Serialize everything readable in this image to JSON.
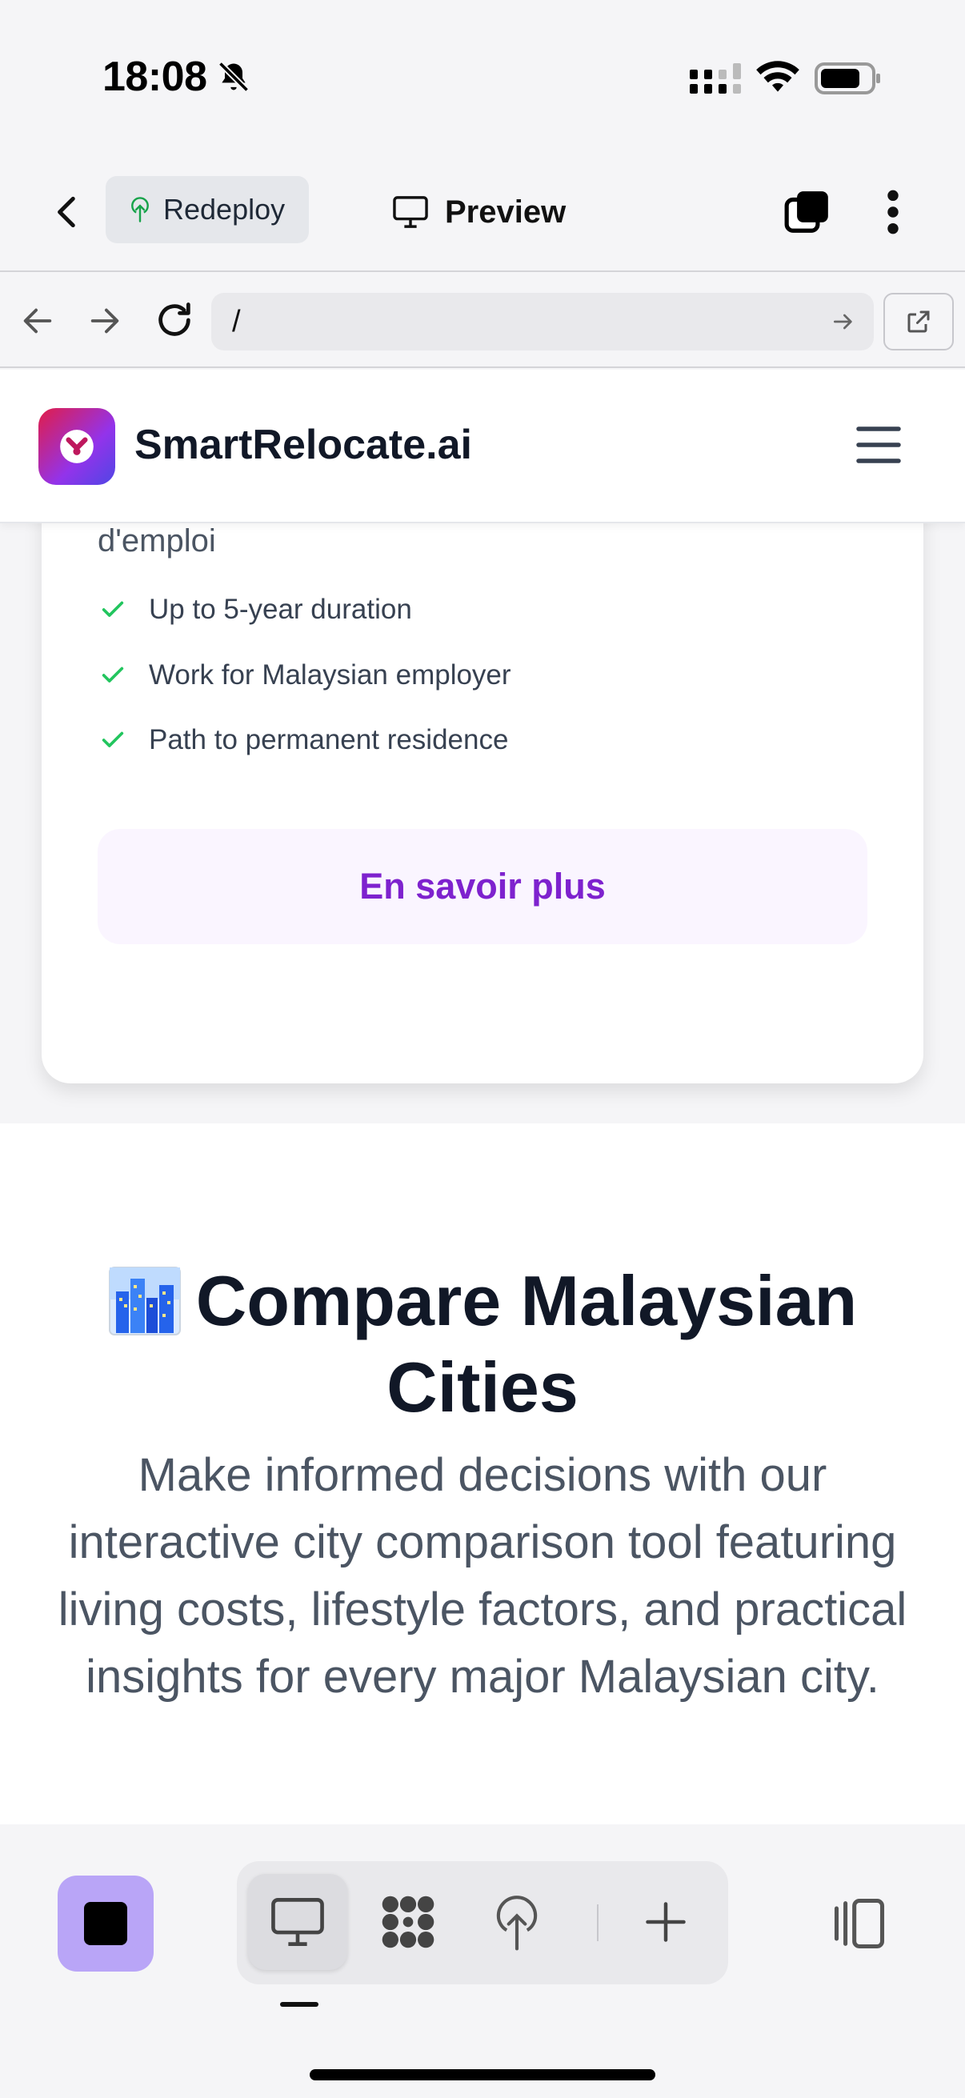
{
  "status_bar": {
    "time": "18:08",
    "icons": [
      "bell-slash-icon",
      "signal-icon",
      "wifi-icon",
      "battery-icon"
    ]
  },
  "toolbar": {
    "redeploy_label": "Redeploy",
    "preview_label": "Preview"
  },
  "browser": {
    "url": "/"
  },
  "site": {
    "brand": "SmartRelocate.ai",
    "card": {
      "subtitle_fragment": "d'emploi",
      "features": [
        "Up to 5-year duration",
        "Work for Malaysian employer",
        "Path to permanent residence"
      ],
      "cta_label": "En savoir plus"
    },
    "section": {
      "emoji": "🏙️",
      "title_line1": "Compare Malaysian",
      "title_line2": "Cities",
      "description": "Make informed decisions with our interactive city comparison tool featuring living costs, lifestyle factors, and practical insights for every major Malaysian city."
    }
  },
  "colors": {
    "accent_purple": "#7e22ce",
    "check_green": "#22c55e",
    "stop_button": "#b9a5f7"
  }
}
